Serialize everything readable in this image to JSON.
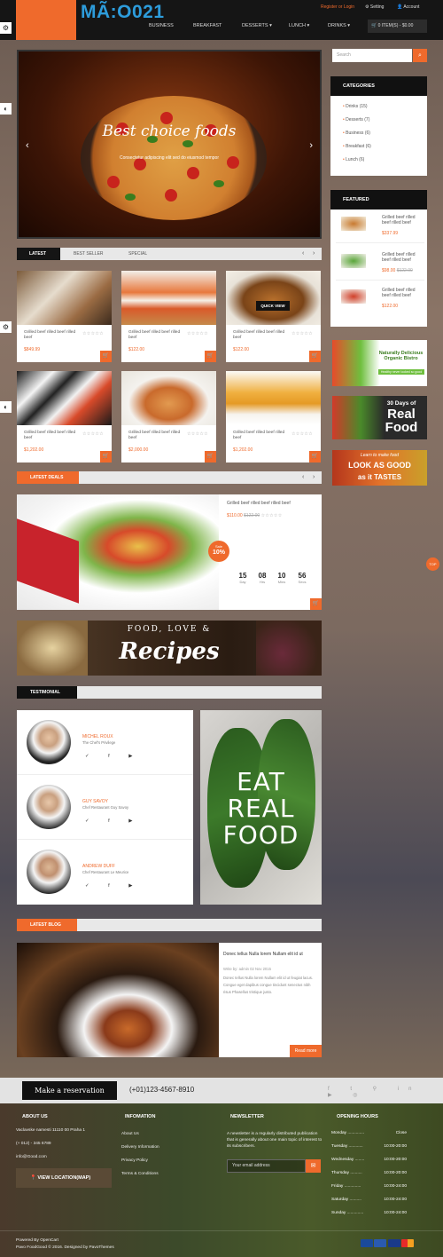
{
  "header": {
    "code": "MÃ:O021",
    "top_links": {
      "register": "Register or Login",
      "setting": "Setting",
      "account": "Account"
    },
    "nav": [
      "BUSINESS",
      "BREAKFAST",
      "DESSERTS ▾",
      "LUNCH ▾",
      "DRINKS ▾"
    ],
    "cart": "0 ITEM(S) - $0.00"
  },
  "slider": {
    "title": "Best choice foods",
    "subtitle": "Consectetur adipiscing elit sed do eiusmod tempor"
  },
  "tabs": [
    "LATEST",
    "BEST SELLER",
    "SPECIAL"
  ],
  "products": [
    {
      "name": "Grilled beef rilled beef rilled beef",
      "price": "$849.99",
      "quick": ""
    },
    {
      "name": "Grilled beef rilled beef rilled beef",
      "price": "$122.00",
      "quick": ""
    },
    {
      "name": "Grilled beef rilled beef rilled beef",
      "price": "$122.00",
      "quick": "QUICK VIEW"
    },
    {
      "name": "Grilled beef rilled beef rilled beef",
      "price": "$1,202.00",
      "quick": ""
    },
    {
      "name": "Grilled beef rilled beef rilled beef",
      "price": "$2,000.00",
      "quick": ""
    },
    {
      "name": "Grilled beef rilled beef rilled beef",
      "price": "$1,202.00",
      "quick": ""
    }
  ],
  "search": {
    "placeholder": "Search"
  },
  "categories": {
    "title": "CATEGORIES",
    "items": [
      "Drinks (15)",
      "Desserts (7)",
      "Business (6)",
      "Breakfast (6)",
      "Lunch (6)"
    ]
  },
  "featured": {
    "title": "FEATURED",
    "items": [
      {
        "name": "Grilled beef rilled beef rilled beef",
        "price": "$337.99"
      },
      {
        "name": "Grilled beef rilled beef rilled beef",
        "price": "$98.00",
        "old": "$122.00"
      },
      {
        "name": "Grilled beef rilled beef rilled beef",
        "price": "$122.00"
      }
    ]
  },
  "banners": {
    "b1": "Naturally Delicious Organic Bistro",
    "b1sub": "Healthy never looked so good",
    "b2a": "30 Days of",
    "b2b": "Real Food",
    "b3a": "Learn to make food",
    "b3b": "LOOK AS GOOD",
    "b3c": "as it TASTES"
  },
  "latest_deals": {
    "title": "LATEST DEALS",
    "name": "Grilled beef rilled beef rilled beef",
    "price": "$110.00",
    "old": "$122.00",
    "sale": "Sale",
    "pct": "10%",
    "countdown": [
      {
        "n": "15",
        "l": "Day"
      },
      {
        "n": "08",
        "l": "Hrs"
      },
      {
        "n": "10",
        "l": "Mins"
      },
      {
        "n": "56",
        "l": "Secs"
      }
    ]
  },
  "recipes": {
    "line1": "FOOD, LOVE &",
    "line2": "Recipes"
  },
  "testimonial": {
    "title": "TESTIMONIAL",
    "people": [
      {
        "name": "MICHEL ROUX",
        "role": "The Chef's Privilege"
      },
      {
        "name": "GUY SAVOY",
        "role": "Chef Restaurant Guy Savoy"
      },
      {
        "name": "ANDREW DUFF",
        "role": "Chef Restaurant Le Meurice"
      }
    ],
    "social": "✓ f ▶"
  },
  "eat": {
    "l1": "EAT",
    "l2": "REAL",
    "l3": "FOOD"
  },
  "blog": {
    "title": "LATEST BLOG",
    "post_title": "Donec tellus Nulla lorem Nullam elit id ut",
    "meta": "Write by: admin  02 Nov 2015",
    "excerpt": "Donec tellus Nulla lorem Nullam elit id ut feugiat lacus. Congue eget dapibus congue tincidunt senectus nibh risus Phasellus tristique justo.",
    "read": "Read more"
  },
  "reservation": {
    "label": "Make a reservation",
    "phone": "(+01)123-4567-8910"
  },
  "footer": {
    "about": {
      "title": "ABOUT US",
      "address": "Vaclavske namesti 11110 00 Praha 1",
      "phone": "(+ 012) - 345 6789",
      "email": "info@Good.com",
      "map": "VIEW LOCATION(MAP)"
    },
    "info": {
      "title": "INFOMATION",
      "links": [
        "About Us",
        "Delivery Information",
        "Privacy Policy",
        "Terms & Conditions"
      ]
    },
    "newsletter": {
      "title": "NEWSLETTER",
      "text": "A newsletter is a regularly distributed publication that is generally about one main topic of interest to its subscribers.",
      "placeholder": "Your email address"
    },
    "hours": {
      "title": "OPENING HOURS",
      "rows": [
        {
          "d": "Monday",
          "t": "Close"
        },
        {
          "d": "Tuesday",
          "t": "10:00-20:00"
        },
        {
          "d": "Wednesday",
          "t": "10:00-20:00"
        },
        {
          "d": "Thursday",
          "t": "10:00-20:00"
        },
        {
          "d": "Friday",
          "t": "10:00-24:00"
        },
        {
          "d": "Saturday",
          "t": "10:00-24:00"
        },
        {
          "d": "Sunday",
          "t": "10:00-24:00"
        }
      ]
    },
    "powered": "Powered By OpenCart",
    "copy": "Pavo FoodGood © 2016. Designed by PavoThemes"
  },
  "top": "TOP",
  "colors": {
    "accent": "#ef6a2c",
    "dark": "#151515",
    "code": "#2d9cdb"
  }
}
